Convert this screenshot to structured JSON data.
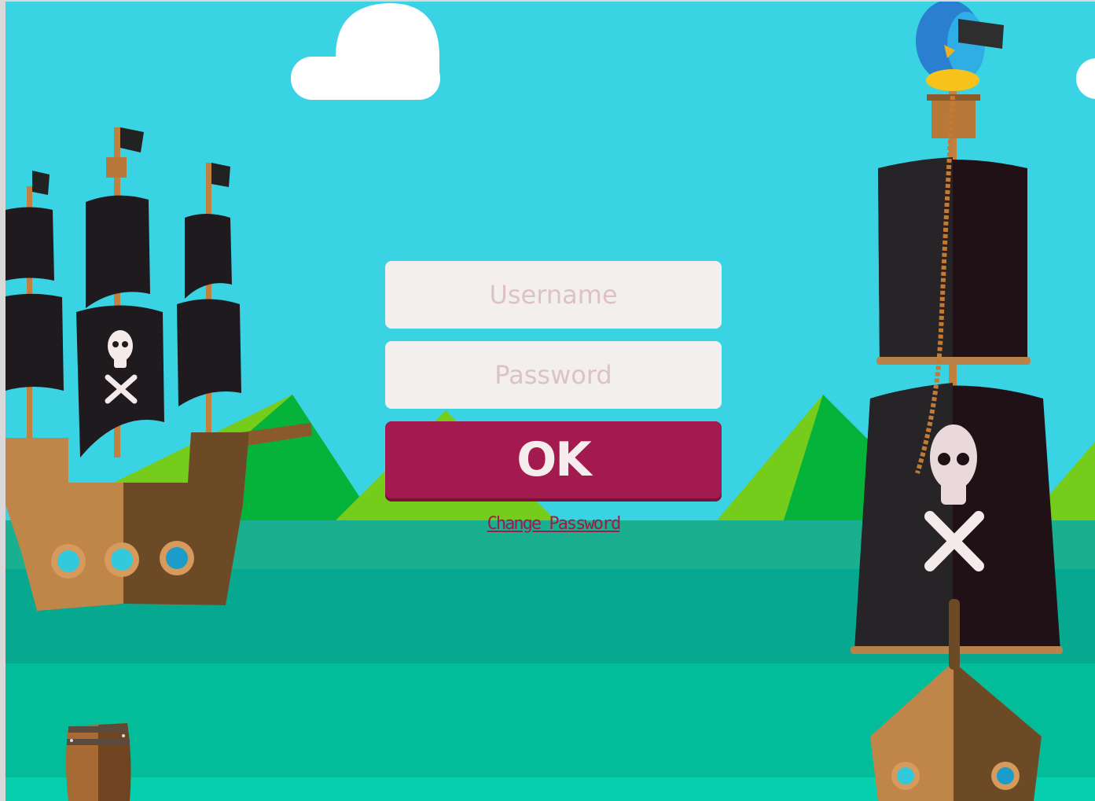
{
  "login": {
    "username_placeholder": "Username",
    "password_placeholder": "Password",
    "ok_label": "OK",
    "change_password_label": "Change Password"
  },
  "theme": {
    "sky": "#3ad3e3",
    "accent": "#a31a4e",
    "field_bg": "#f3efef"
  }
}
